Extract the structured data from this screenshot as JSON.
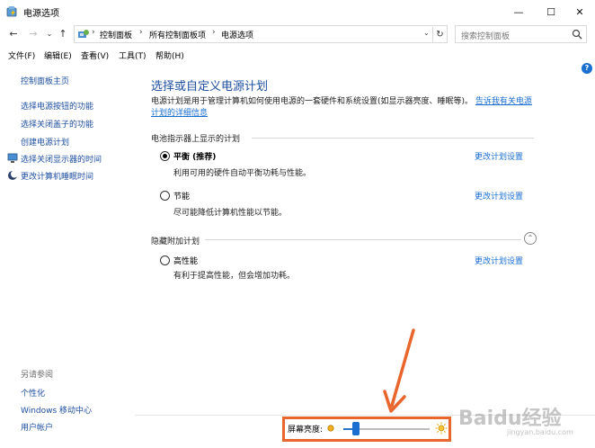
{
  "window": {
    "title": "电源选项",
    "minimize_glyph": "—",
    "maximize_glyph": "☐",
    "close_glyph": "✕"
  },
  "address": {
    "back_glyph": "←",
    "forward_glyph": "→",
    "recent_glyph": "⌄",
    "up_glyph": "↑",
    "breadcrumbs": [
      "控制面板",
      "所有控制面板项",
      "电源选项"
    ],
    "separator": "›",
    "dropdown_glyph": "⌄",
    "refresh_glyph": "↻",
    "search_placeholder": "搜索控制面板"
  },
  "menu": {
    "items": [
      "文件(F)",
      "编辑(E)",
      "查看(V)",
      "工具(T)",
      "帮助(H)"
    ]
  },
  "help_glyph": "?",
  "sidebar": {
    "home": "控制面板主页",
    "links": [
      "选择电源按钮的功能",
      "选择关闭盖子的功能",
      "创建电源计划",
      "选择关闭显示器的时间",
      "更改计算机睡眠时间"
    ],
    "see_also_title": "另请参阅",
    "see_also": [
      "个性化",
      "Windows 移动中心",
      "用户帐户"
    ]
  },
  "main": {
    "title": "选择或自定义电源计划",
    "description": "电源计划是用于管理计算机如何使用电源的一套硬件和系统设置(如显示器亮度、睡眠等)。",
    "description_link": "告诉我有关电源计划的详细信息",
    "section_battery": "电池指示器上显示的计划",
    "section_hidden": "隐藏附加计划",
    "collapse_glyph": "⌃",
    "plans": [
      {
        "name": "平衡 (推荐)",
        "description": "利用可用的硬件自动平衡功耗与性能。",
        "link": "更改计划设置",
        "selected": true
      },
      {
        "name": "节能",
        "description": "尽可能降低计算机性能以节能。",
        "link": "更改计划设置",
        "selected": false
      },
      {
        "name": "高性能",
        "description": "有利于提高性能，但会增加功耗。",
        "link": "更改计划设置",
        "selected": false
      }
    ]
  },
  "status": {
    "brightness_label": "屏幕亮度:",
    "brightness_value": 0.15
  },
  "colors": {
    "accent": "#1a6fd1",
    "highlight": "#e8652c"
  },
  "watermark": {
    "brand": "Baidu经验",
    "url": "jingyan.baidu.com"
  }
}
